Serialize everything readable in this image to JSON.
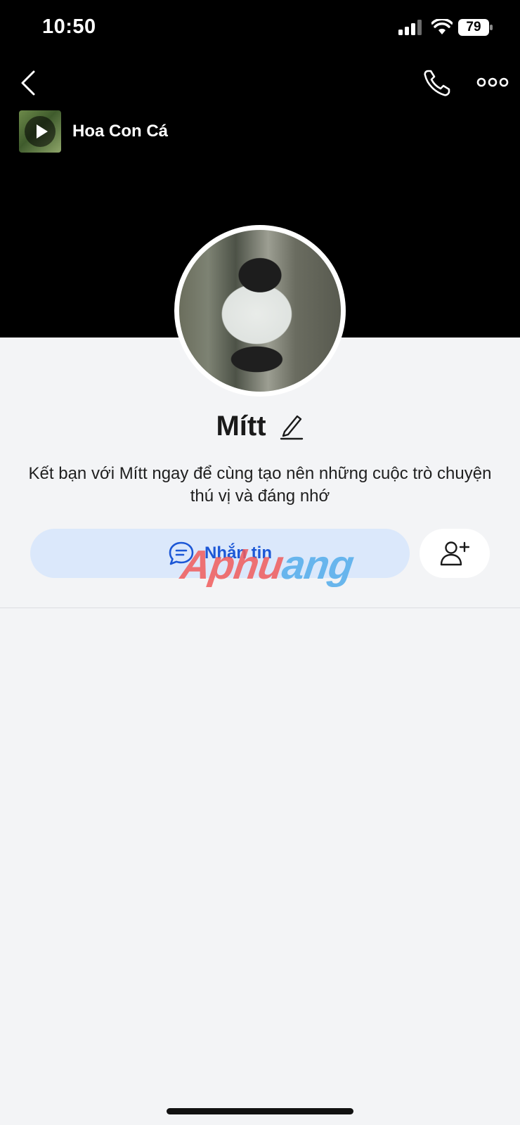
{
  "status_bar": {
    "time": "10:50",
    "battery": "79"
  },
  "header": {
    "back_icon": "chevron-left-icon",
    "call_icon": "phone-icon",
    "more_icon": "ellipsis-icon"
  },
  "music": {
    "title": "Hoa Con Cá",
    "icon": "play-icon"
  },
  "profile": {
    "name": "Mítt",
    "edit_icon": "pencil-icon",
    "intro": "Kết bạn với Mítt ngay để cùng tạo nên những cuộc trò chuyện thú vị và đáng nhớ",
    "message_label": "Nhắn tin",
    "message_icon": "chat-bubble-icon",
    "add_friend_icon": "add-user-icon"
  },
  "watermark": {
    "main": "Aphu",
    "tail": "ang"
  },
  "colors": {
    "cover": "#000000",
    "page_bg": "#f3f4f6",
    "accent": "#1c57d6",
    "message_bg": "#dbe8fb"
  }
}
